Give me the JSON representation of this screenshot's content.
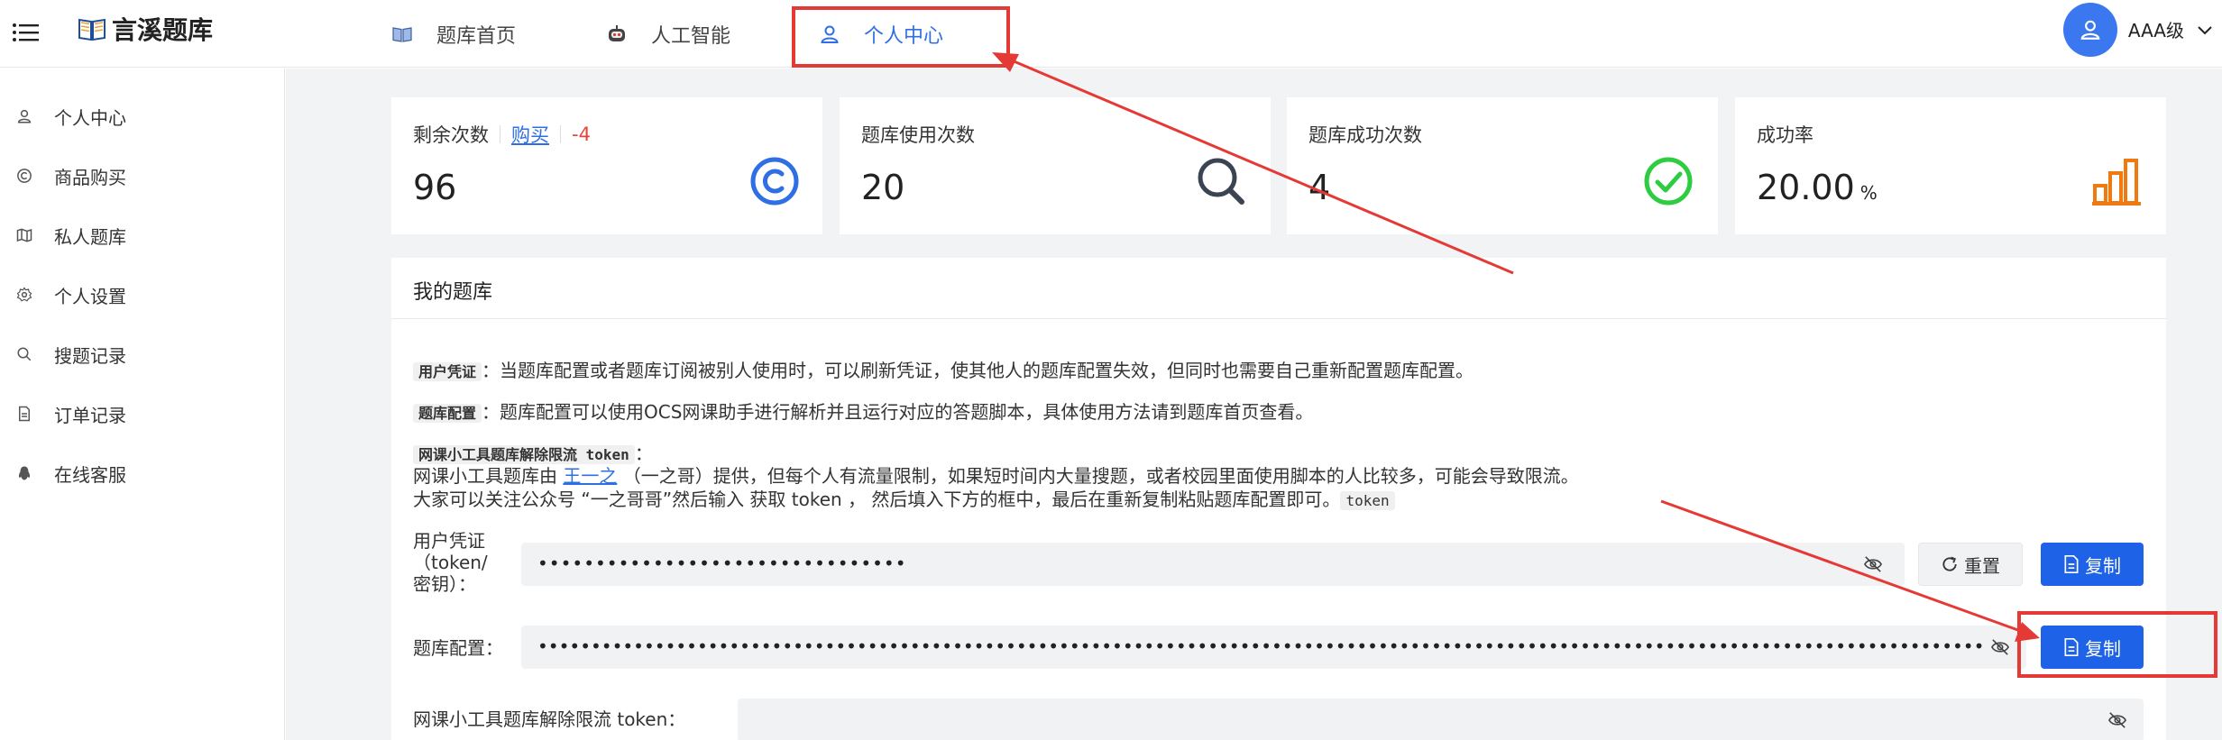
{
  "header": {
    "logo_text": "言溪题库",
    "nav": [
      {
        "label": "题库首页",
        "icon": "book-icon"
      },
      {
        "label": "人工智能",
        "icon": "robot-icon"
      },
      {
        "label": "个人中心",
        "icon": "user-icon",
        "active": true
      }
    ],
    "user_level": "AAA级"
  },
  "sidebar": {
    "items": [
      {
        "label": "个人中心",
        "icon": "user-icon"
      },
      {
        "label": "商品购买",
        "icon": "copyright-icon"
      },
      {
        "label": "私人题库",
        "icon": "map-icon"
      },
      {
        "label": "个人设置",
        "icon": "gear-icon"
      },
      {
        "label": "搜题记录",
        "icon": "search-icon"
      },
      {
        "label": "订单记录",
        "icon": "document-icon"
      },
      {
        "label": "在线客服",
        "icon": "penguin-icon"
      }
    ]
  },
  "stats": {
    "remaining": {
      "title": "剩余次数",
      "buy": "购买",
      "delta": "-4",
      "value": "96"
    },
    "usage": {
      "title": "题库使用次数",
      "value": "20"
    },
    "success": {
      "title": "题库成功次数",
      "value": "4"
    },
    "rate": {
      "title": "成功率",
      "value": "20.00",
      "unit": "%"
    }
  },
  "bank": {
    "title": "我的题库",
    "p1_tag": "用户凭证",
    "p1_text": "：当题库配置或者题库订阅被别人使用时，可以刷新凭证，使其他人的题库配置失效，但同时也需要自己重新配置题库配置。",
    "p2_tag": "题库配置",
    "p2_text": "：题库配置可以使用OCS网课助手进行解析并且运行对应的答题脚本，具体使用方法请到题库首页查看。",
    "p3_tag": "网课小工具题库解除限流 token",
    "p3_colon": "：",
    "p4_pre": "网课小工具题库由 ",
    "p4_link": "王一之",
    "p4_post": " （一之哥）提供，但每个人有流量限制，如果短时间内大量搜题，或者校园里面使用脚本的人比较多，可能会导致限流。",
    "p5_text": "大家可以关注公众号 “一之哥哥”然后输入 获取 token ， 然后填入下方的框中，最后在重新复制粘贴题库配置即可。",
    "p5_code": "token",
    "token_label_1": "用户凭证",
    "token_label_2": "（token/",
    "token_label_3": "密钥）：",
    "token_value": "••••••••••••••••••••••••••••••••",
    "reset_label": "重置",
    "copy_label": "复制",
    "config_label": "题库配置：",
    "config_value": "••••••••••••••••••••••••••••••••••••••••••••••••••••••••••••••••••••••••••••••••••••••••••••••••••••••••••••••••••••••••••••••••••••••••••••••••",
    "limit_label": "网课小工具题库解除限流 token：",
    "limit_value": ""
  },
  "colors": {
    "accent": "#1e62e8",
    "annotation": "#e53935",
    "success": "#2ecc40",
    "orange": "#f07a10"
  }
}
